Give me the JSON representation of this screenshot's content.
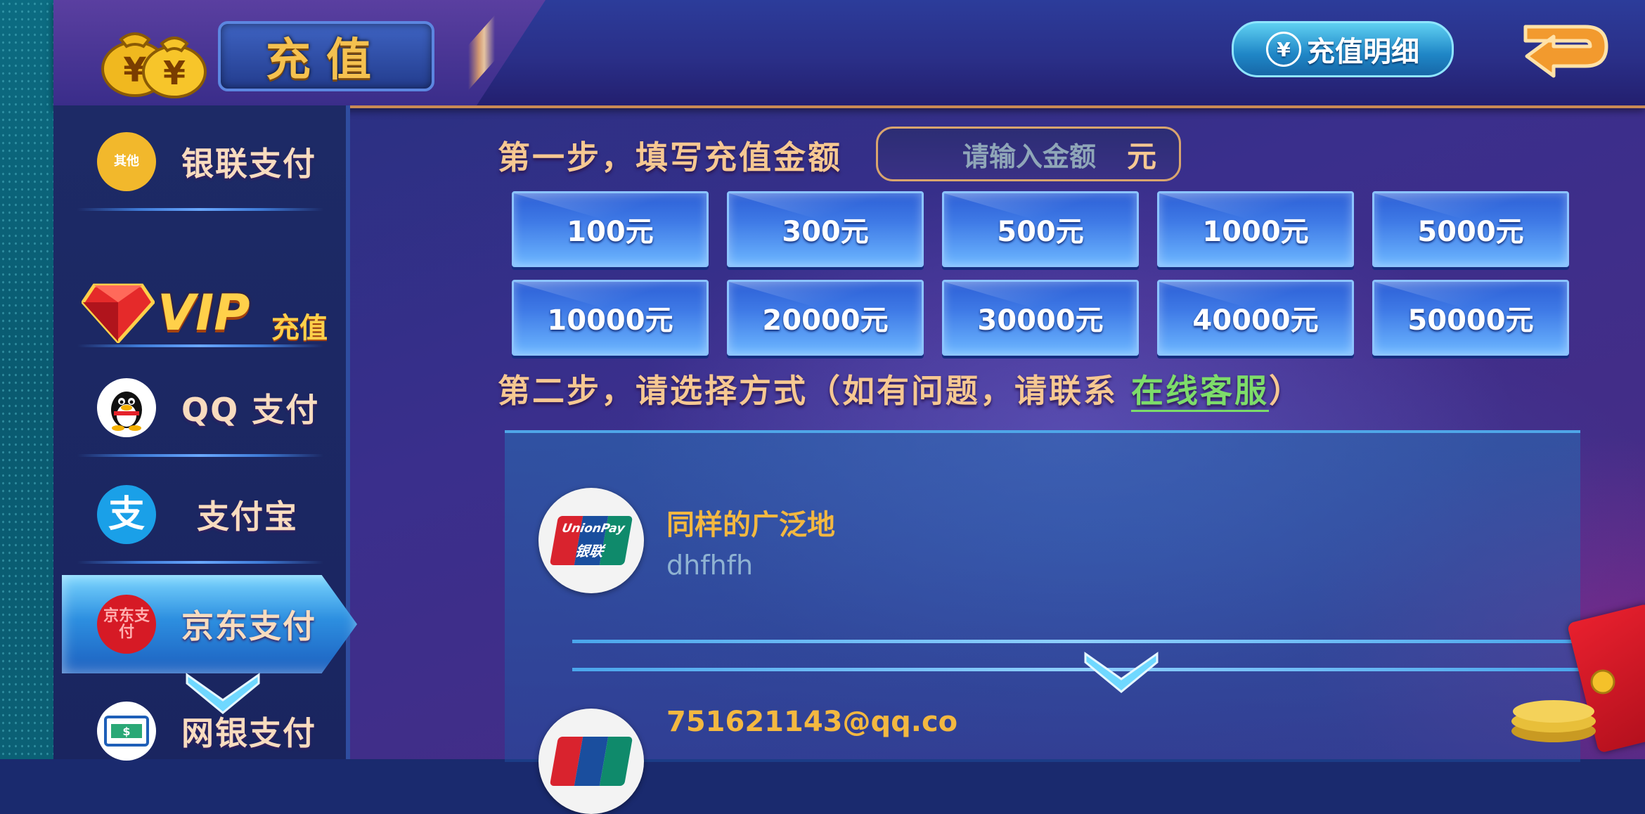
{
  "header": {
    "title": "充值",
    "detail_button": "充值明细",
    "detail_icon": "yen-circle-icon",
    "back_icon": "return-arrow-icon"
  },
  "sidebar": {
    "items": [
      {
        "label": "银联支付",
        "icon": "其他",
        "icon_color": "#f2b82c"
      },
      {
        "label": "VIP",
        "sub": "充值",
        "icon": "diamond-icon"
      },
      {
        "label": "QQ 支付",
        "icon": "qq-penguin-icon",
        "icon_color": "#ffffff"
      },
      {
        "label": "支付宝",
        "icon": "支",
        "icon_color": "#1aa0e8"
      },
      {
        "label": "京东支付",
        "icon": "京东支付",
        "icon_color": "#d61a25",
        "active": true
      },
      {
        "label": "网银支付",
        "icon": "bank-card-icon",
        "icon_color": "#ffffff"
      }
    ]
  },
  "step1": {
    "label": "第一步，填写充值金额",
    "input_placeholder": "请输入金额",
    "input_unit": "元",
    "amounts": [
      "100元",
      "300元",
      "500元",
      "1000元",
      "5000元",
      "10000元",
      "20000元",
      "30000元",
      "40000元",
      "50000元"
    ]
  },
  "step2": {
    "label_prefix": "第二步，请选择方式（如有问题，请联系 ",
    "link": "在线客服",
    "label_suffix": "）"
  },
  "payments": [
    {
      "name": "同样的广泛地",
      "detail": "dhfhfh",
      "logo": "unionpay-icon",
      "logo_text_top": "UnionPay",
      "logo_text_bottom": "银联"
    },
    {
      "name": "751621143@qq.co",
      "detail": "",
      "logo": "unionpay-icon"
    }
  ],
  "colors": {
    "accent_gold": "#f6c892",
    "link_green": "#7ddc6a",
    "button_blue": "#3f7ae6"
  }
}
